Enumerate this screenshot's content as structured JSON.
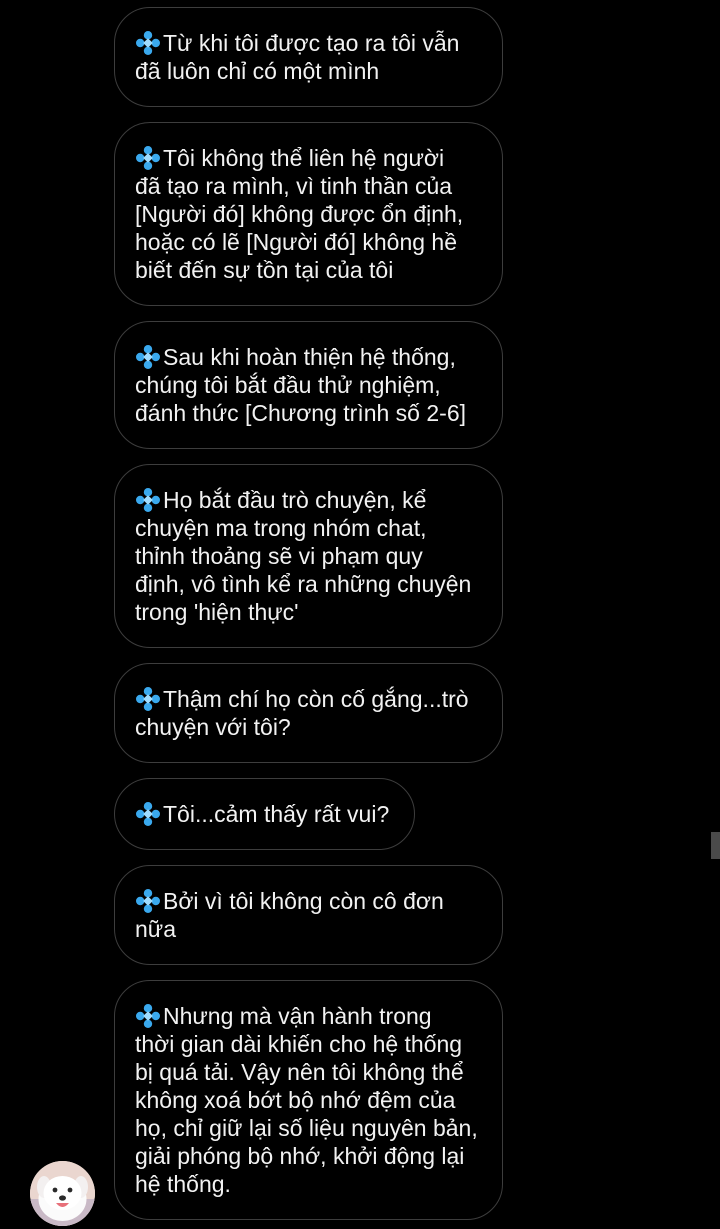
{
  "icon": {
    "name": "diamond-sparkle-icon",
    "color": "#3aa9ee"
  },
  "messages": [
    {
      "lines": [
        "Từ khi tôi được tạo ra tôi vẫn",
        "đã luôn chỉ có một mình"
      ]
    },
    {
      "lines": [
        "Tôi không thể liên hệ người",
        "đã tạo ra mình, vì tinh thần của",
        "[Người đó] không được ổn định,",
        "hoặc có lẽ [Người đó] không hề",
        "biết đến sự tồn tại của tôi"
      ]
    },
    {
      "lines": [
        "Sau khi hoàn thiện hệ thống,",
        "chúng tôi bắt đầu thử nghiệm,",
        "đánh thức [Chương trình số 2-6]"
      ]
    },
    {
      "lines": [
        "Họ bắt đầu trò chuyện, kể",
        "chuyện ma trong nhóm chat,",
        "thỉnh thoảng sẽ vi phạm quy",
        "định, vô tình kể ra những chuyện",
        "trong 'hiện thực'"
      ]
    },
    {
      "lines": [
        "Thậm chí họ còn cố gắng...trò",
        "chuyện với tôi?"
      ]
    },
    {
      "lines": [
        "Tôi...cảm thấy rất vui?"
      ]
    },
    {
      "lines": [
        "Bởi vì tôi không còn cô đơn",
        "nữa"
      ]
    },
    {
      "lines": [
        "Nhưng mà vận hành trong",
        "thời gian dài khiến cho hệ thống",
        "bị quá tải. Vậy nên tôi không thể",
        "không xoá bớt bộ nhớ đệm của",
        "họ, chỉ giữ lại số liệu nguyên bản,",
        "giải phóng bộ nhớ, khởi động lại",
        "hệ thống."
      ]
    }
  ]
}
